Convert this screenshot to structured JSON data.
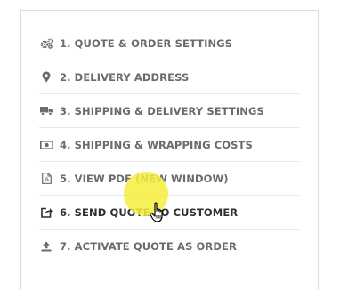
{
  "menu": {
    "items": [
      {
        "label": "1. QUOTE & ORDER SETTINGS",
        "icon": "gears-icon"
      },
      {
        "label": "2. DELIVERY ADDRESS",
        "icon": "map-marker-icon"
      },
      {
        "label": "3. SHIPPING & DELIVERY SETTINGS",
        "icon": "truck-icon"
      },
      {
        "label": "4. SHIPPING & WRAPPING COSTS",
        "icon": "money-icon"
      },
      {
        "label": "5. VIEW PDF (NEW WINDOW)",
        "icon": "pdf-file-icon"
      },
      {
        "label": "6. SEND QUOTE TO CUSTOMER",
        "icon": "share-icon"
      },
      {
        "label": "7. ACTIVATE QUOTE AS ORDER",
        "icon": "upload-icon"
      }
    ],
    "active_item": "6. SEND QUOTE TO CUSTOMER"
  },
  "colors": {
    "text": "#6b6b6b",
    "active_text": "#2f2f2f",
    "border": "#dcdcdc",
    "click_highlight": "#f5ee3c"
  }
}
